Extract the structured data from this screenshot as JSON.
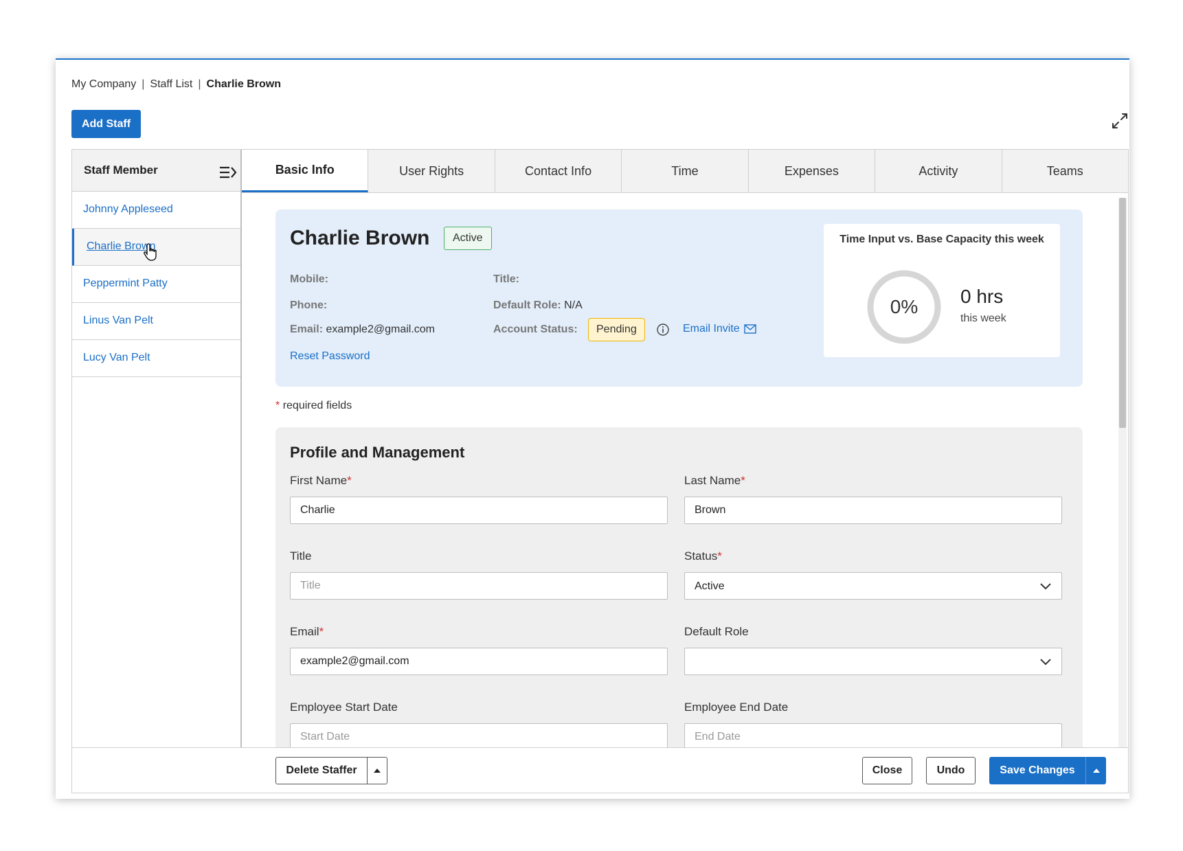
{
  "breadcrumb": {
    "company": "My Company",
    "list": "Staff List",
    "current": "Charlie Brown",
    "sep": "|"
  },
  "toolbar": {
    "add_staff": "Add Staff",
    "expand_icon": "expand-arrows-icon"
  },
  "sidebar": {
    "header": "Staff Member",
    "collapse_icon": "collapse-panel-icon",
    "items": [
      {
        "label": "Johnny Appleseed"
      },
      {
        "label": "Charlie Brown",
        "selected": true
      },
      {
        "label": "Peppermint Patty"
      },
      {
        "label": "Linus Van Pelt"
      },
      {
        "label": "Lucy Van Pelt"
      }
    ]
  },
  "tabs": [
    {
      "label": "Basic Info",
      "active": true
    },
    {
      "label": "User Rights"
    },
    {
      "label": "Contact Info"
    },
    {
      "label": "Time"
    },
    {
      "label": "Expenses"
    },
    {
      "label": "Activity"
    },
    {
      "label": "Teams"
    }
  ],
  "summary": {
    "name": "Charlie Brown",
    "status_badge": "Active",
    "mobile_label": "Mobile:",
    "mobile_value": "",
    "phone_label": "Phone:",
    "phone_value": "",
    "email_label": "Email:",
    "email_value": "example2@gmail.com",
    "title_label": "Title:",
    "title_value": "",
    "role_label": "Default Role:",
    "role_value": "N/A",
    "account_label": "Account Status:",
    "account_value": "Pending",
    "email_invite": "Email Invite",
    "reset_password": "Reset Password",
    "capacity": {
      "title": "Time Input vs. Base Capacity this week",
      "percent_label": "0%",
      "percent": 0,
      "hours": "0 hrs",
      "hours_sub": "this week"
    }
  },
  "required_note": {
    "star": "*",
    "text": "required fields"
  },
  "profile": {
    "heading": "Profile and Management",
    "first_name": {
      "label": "First Name",
      "value": "Charlie"
    },
    "last_name": {
      "label": "Last Name",
      "value": "Brown"
    },
    "title": {
      "label": "Title",
      "value": "",
      "placeholder": "Title"
    },
    "status": {
      "label": "Status",
      "value": "Active"
    },
    "email": {
      "label": "Email",
      "value": "example2@gmail.com"
    },
    "default_role": {
      "label": "Default Role",
      "value": ""
    },
    "start_date": {
      "label": "Employee Start Date",
      "value": "",
      "placeholder": "Start Date"
    },
    "end_date": {
      "label": "Employee End Date",
      "value": "",
      "placeholder": "End Date"
    },
    "required_star": "*"
  },
  "footer": {
    "delete": "Delete Staffer",
    "close": "Close",
    "undo": "Undo",
    "save": "Save Changes"
  },
  "colors": {
    "accent": "#1a6fc7",
    "summary_bg": "#e3eefa",
    "pending_bg": "#fff4cf",
    "active_border": "#4caf6a"
  }
}
